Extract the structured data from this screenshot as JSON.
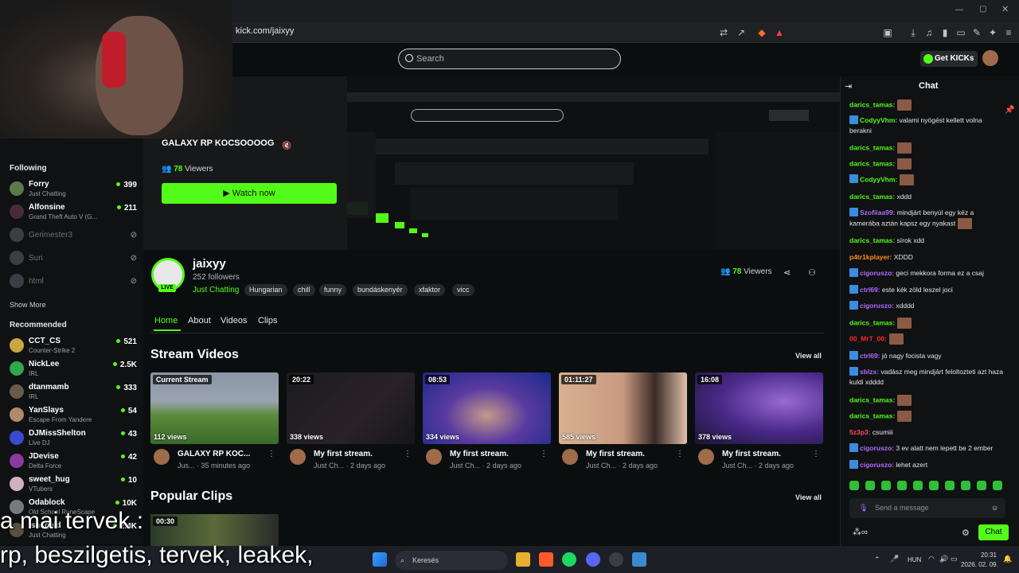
{
  "browser": {
    "url": "kick.com/jaixyy"
  },
  "header": {
    "search_placeholder": "Search",
    "get_kicks": "Get KICKs"
  },
  "sidebar": {
    "following_title": "Following",
    "following": [
      {
        "name": "Forry",
        "category": "Just Chatting",
        "viewers": "399",
        "online": true
      },
      {
        "name": "Alfonsine",
        "category": "Grand Theft Auto V (G...",
        "viewers": "211",
        "online": true
      },
      {
        "name": "Gerimester3",
        "category": "",
        "viewers": "",
        "online": false
      },
      {
        "name": "Suri",
        "category": "",
        "viewers": "",
        "online": false
      },
      {
        "name": "html",
        "category": "",
        "viewers": "",
        "online": false
      }
    ],
    "show_more": "Show More",
    "recommended_title": "Recommended",
    "recommended": [
      {
        "name": "CCT_CS",
        "category": "Counter-Strike 2",
        "viewers": "521"
      },
      {
        "name": "NickLee",
        "category": "IRL",
        "viewers": "2.5K"
      },
      {
        "name": "dtanmamb",
        "category": "IRL",
        "viewers": "333"
      },
      {
        "name": "YanSlays",
        "category": "Escape From Yandere",
        "viewers": "54"
      },
      {
        "name": "DJMissShelton",
        "category": "Live DJ",
        "viewers": "43"
      },
      {
        "name": "JDevise",
        "category": "Delta Force",
        "viewers": "42"
      },
      {
        "name": "sweet_hug",
        "category": "VTubers",
        "viewers": "10"
      },
      {
        "name": "Odablock",
        "category": "Old School RuneScape",
        "viewers": "10K"
      },
      {
        "name": "Isnsgeld",
        "category": "Just Chatting",
        "viewers": "2.4K"
      }
    ]
  },
  "player": {
    "overlay_title": "GALAXY RP KOCSOOOOG",
    "overlay_viewers_count": "78",
    "overlay_viewers_label": "Viewers",
    "watch_now": "Watch now"
  },
  "channel": {
    "name": "jaixyy",
    "followers": "252 followers",
    "category": "Just Chatting",
    "live_badge": "LIVE",
    "tags": [
      "Hungarian",
      "chill",
      "funny",
      "bundáskenyér",
      "xfaktor",
      "vicc"
    ],
    "viewers_count": "78",
    "viewers_label": "Viewers"
  },
  "tabs": [
    "Home",
    "About",
    "Videos",
    "Clips"
  ],
  "stream_videos": {
    "title": "Stream Videos",
    "view_all": "View all",
    "items": [
      {
        "badge": "Current Stream",
        "views": "112 views",
        "title": "GALAXY RP KOC...",
        "meta": "Jus... · 35 minutes ago"
      },
      {
        "badge": "20:22",
        "views": "338 views",
        "title": "My first stream.",
        "meta": "Just Ch... · 2 days ago"
      },
      {
        "badge": "08:53",
        "views": "334 views",
        "title": "My first stream.",
        "meta": "Just Ch... · 2 days ago"
      },
      {
        "badge": "01:11:27",
        "views": "585 views",
        "title": "My first stream.",
        "meta": "Just Ch... · 2 days ago"
      },
      {
        "badge": "16:08",
        "views": "378 views",
        "title": "My first stream.",
        "meta": "Just Ch... · 2 days ago"
      }
    ]
  },
  "popular_clips": {
    "title": "Popular Clips",
    "view_all": "View all",
    "first_badge": "00:30"
  },
  "chat": {
    "title": "Chat",
    "messages": [
      {
        "user": "darics_tamas:",
        "color": "#53fc18",
        "text": "",
        "emote": true,
        "badge": false
      },
      {
        "user": "CodyyVhm:",
        "color": "#53fc18",
        "text": "valami nyögést kellett volna berakni",
        "emote": false,
        "badge": true
      },
      {
        "user": "darics_tamas:",
        "color": "#53fc18",
        "text": "",
        "emote": true,
        "badge": false
      },
      {
        "user": "darics_tamas:",
        "color": "#53fc18",
        "text": "",
        "emote": true,
        "badge": false
      },
      {
        "user": "CodyyVhm:",
        "color": "#53fc18",
        "text": "",
        "emote": true,
        "badge": true
      },
      {
        "user": "darics_tamas:",
        "color": "#53fc18",
        "text": "xddd",
        "emote": false,
        "badge": false
      },
      {
        "user": "Szofiiaa99:",
        "color": "#b36bff",
        "text": "mindjárt benyúl egy kéz a kamerába aztán kapsz egy nyakast",
        "emote": true,
        "badge": true
      },
      {
        "user": "darics_tamas:",
        "color": "#53fc18",
        "text": "sírok xdd",
        "emote": false,
        "badge": false
      },
      {
        "user": "p4tr1kplayer:",
        "color": "#ff8a1a",
        "text": "XDDD",
        "emote": false,
        "badge": false
      },
      {
        "user": "cigoruszo:",
        "color": "#b36bff",
        "text": "geci mekkora forma ez a csaj",
        "emote": false,
        "badge": true
      },
      {
        "user": "ctrl69:",
        "color": "#b36bff",
        "text": "este kék zöld leszel joci",
        "emote": false,
        "badge": true
      },
      {
        "user": "cigoruszo:",
        "color": "#b36bff",
        "text": "xdddd",
        "emote": false,
        "badge": true
      },
      {
        "user": "darics_tamas:",
        "color": "#53fc18",
        "text": "",
        "emote": true,
        "badge": false
      },
      {
        "user": "00_MrT_00:",
        "color": "#ff2a2a",
        "text": "",
        "emote": true,
        "badge": false
      },
      {
        "user": "ctrl69:",
        "color": "#b36bff",
        "text": "jó nagy focista vagy",
        "emote": false,
        "badge": true
      },
      {
        "user": "sblzs:",
        "color": "#b36bff",
        "text": "vadász meg mindjárt feloltozteti azt haza kuldi xdddd",
        "emote": false,
        "badge": true
      },
      {
        "user": "darics_tamas:",
        "color": "#53fc18",
        "text": "",
        "emote": true,
        "badge": false
      },
      {
        "user": "darics_tamas:",
        "color": "#53fc18",
        "text": "",
        "emote": true,
        "badge": false
      },
      {
        "user": "5z3p3:",
        "color": "#ff4a6a",
        "text": "csumiii",
        "emote": false,
        "badge": false
      },
      {
        "user": "cigoruszo:",
        "color": "#b36bff",
        "text": "3 ev alatt nem lepett be 2 ember",
        "emote": false,
        "badge": true
      },
      {
        "user": "cigoruszo:",
        "color": "#b36bff",
        "text": "lehet azert",
        "emote": false,
        "badge": true
      }
    ],
    "input_placeholder": "Send a message",
    "send_label": "Chat"
  },
  "overlay_text": {
    "line1": "a mai tervek :",
    "line2": "rp, beszilgetis, tervek, leakek,"
  },
  "taskbar": {
    "search": "Keresés",
    "lang": "HUN",
    "time": "20:31",
    "date": "2026. 02. 09."
  }
}
